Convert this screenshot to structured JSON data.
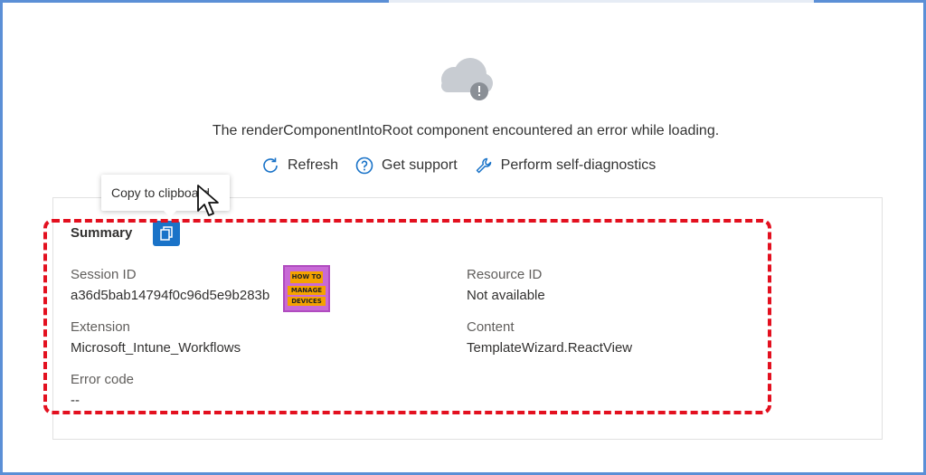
{
  "error": {
    "message": "The renderComponentIntoRoot component encountered an error while loading.",
    "icon": "cloud-warning-icon"
  },
  "actions": [
    {
      "label": "Refresh",
      "icon": "refresh-icon"
    },
    {
      "label": "Get support",
      "icon": "help-circle-icon"
    },
    {
      "label": "Perform self-diagnostics",
      "icon": "wrench-icon"
    }
  ],
  "tooltip": {
    "text": "Copy to clipboard"
  },
  "summary": {
    "title": "Summary",
    "fields": {
      "session_id": {
        "label": "Session ID",
        "value": "a36d5bab14794f0c96d5e9b283b"
      },
      "resource_id": {
        "label": "Resource ID",
        "value": "Not available"
      },
      "extension": {
        "label": "Extension",
        "value": "Microsoft_Intune_Workflows"
      },
      "content": {
        "label": "Content",
        "value": "TemplateWizard.ReactView"
      },
      "error_code": {
        "label": "Error code",
        "value": "--"
      }
    }
  },
  "watermark": {
    "line1": "HOW TO",
    "line2": "MANAGE",
    "line3": "DEVICES"
  },
  "colors": {
    "accent": "#1a73c8",
    "highlight": "#e3101f",
    "frame": "#5b8fd6"
  }
}
